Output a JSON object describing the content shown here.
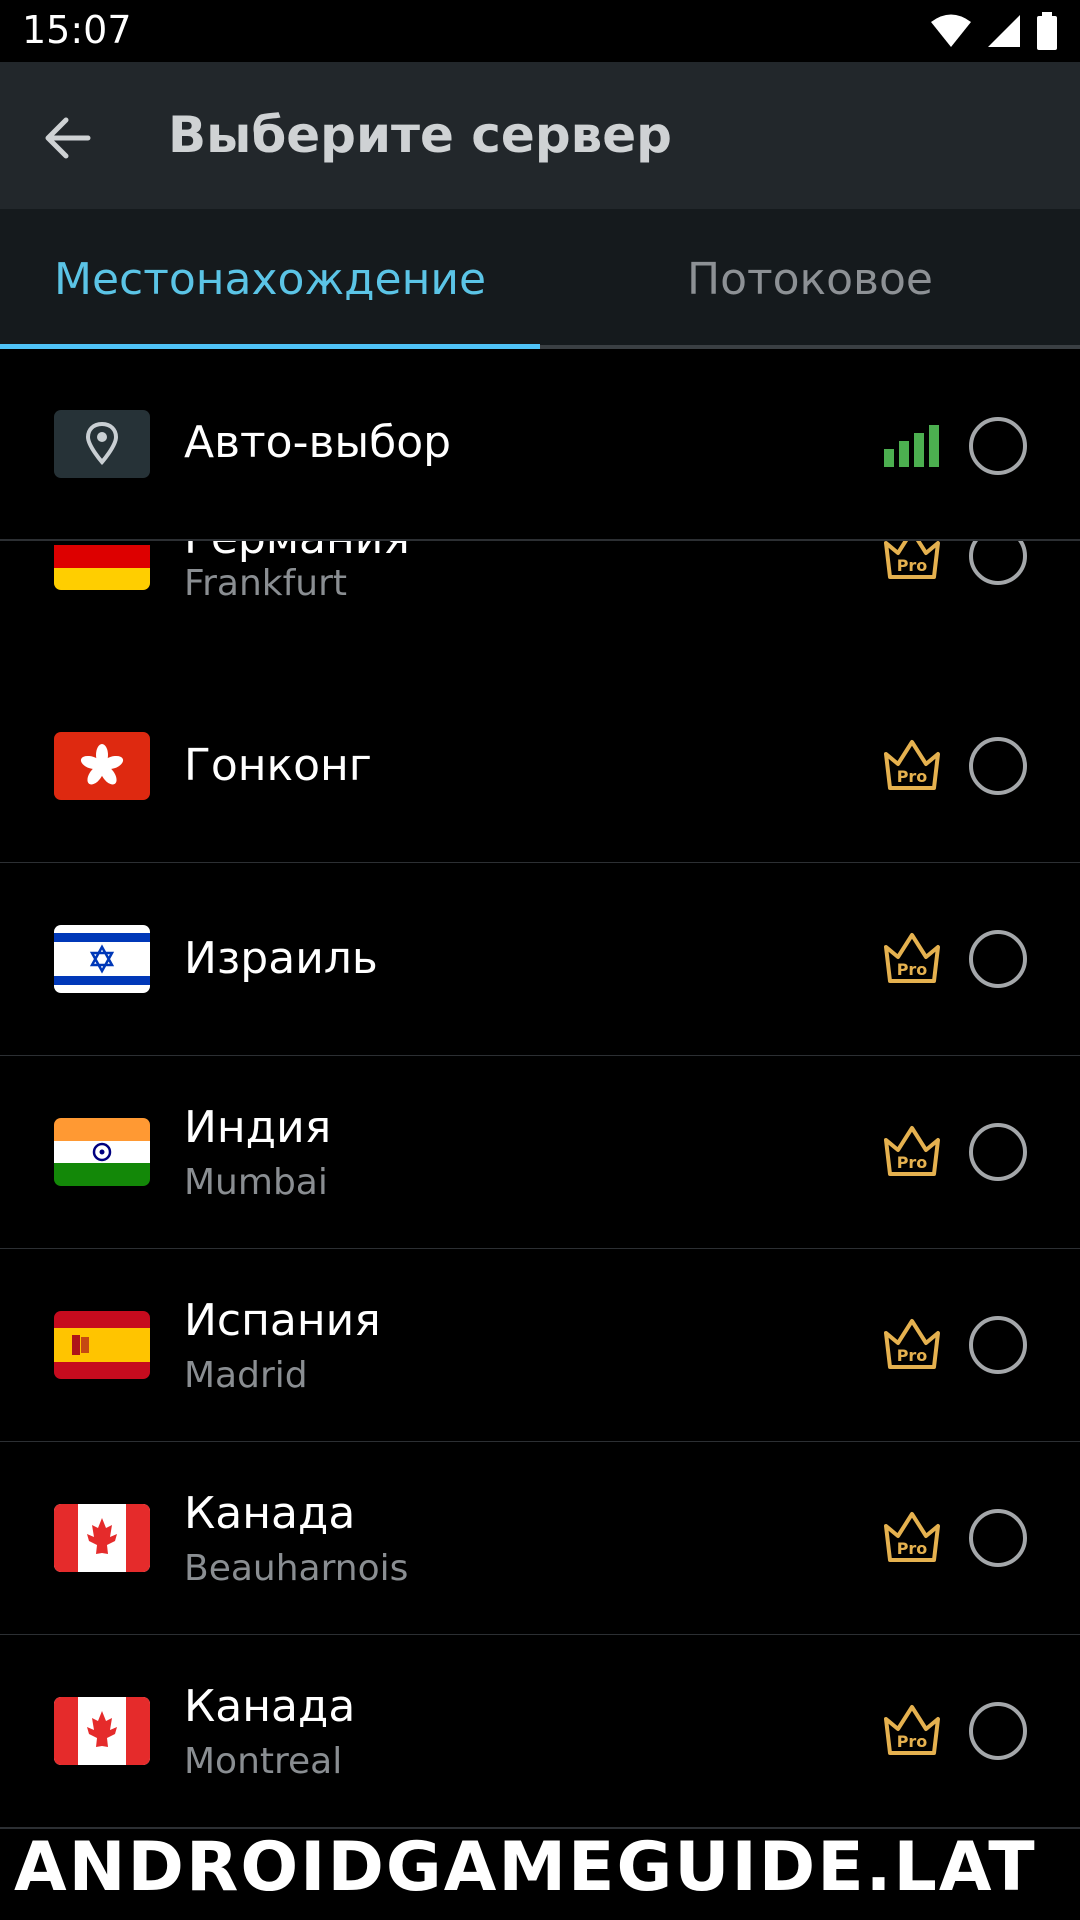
{
  "status_bar": {
    "time": "15:07",
    "icons": [
      "wifi-icon",
      "cell-signal-icon",
      "battery-icon"
    ]
  },
  "app_bar": {
    "title": "Выберите сервер",
    "back_icon": "arrow-back-icon"
  },
  "tabs": [
    {
      "label": "Местонахождение",
      "active": true
    },
    {
      "label": "Потоковое",
      "active": false
    }
  ],
  "colors": {
    "accent": "#4fc3f7",
    "pro": "#e5b14f",
    "signal": "#4caf50",
    "background": "#000000",
    "app_bar": "#22272b"
  },
  "auto_select": {
    "label": "Авто-выбор",
    "icon": "location-pin-icon",
    "status_icon": "signal-bars-icon"
  },
  "servers": [
    {
      "country": "Германия",
      "city": "Frankfurt",
      "flag": "germany-flag",
      "pro": true
    },
    {
      "country": "Гонконг",
      "city": "",
      "flag": "hong-kong-flag",
      "pro": true
    },
    {
      "country": "Израиль",
      "city": "",
      "flag": "israel-flag",
      "pro": true
    },
    {
      "country": "Индия",
      "city": "Mumbai",
      "flag": "india-flag",
      "pro": true
    },
    {
      "country": "Испания",
      "city": "Madrid",
      "flag": "spain-flag",
      "pro": true
    },
    {
      "country": "Канада",
      "city": "Beauharnois",
      "flag": "canada-flag",
      "pro": true
    },
    {
      "country": "Канада",
      "city": "Montreal",
      "flag": "canada-flag",
      "pro": true
    }
  ],
  "pro_badge_text": "Pro",
  "watermark": "ANDROIDGAMEGUIDE.LAT"
}
